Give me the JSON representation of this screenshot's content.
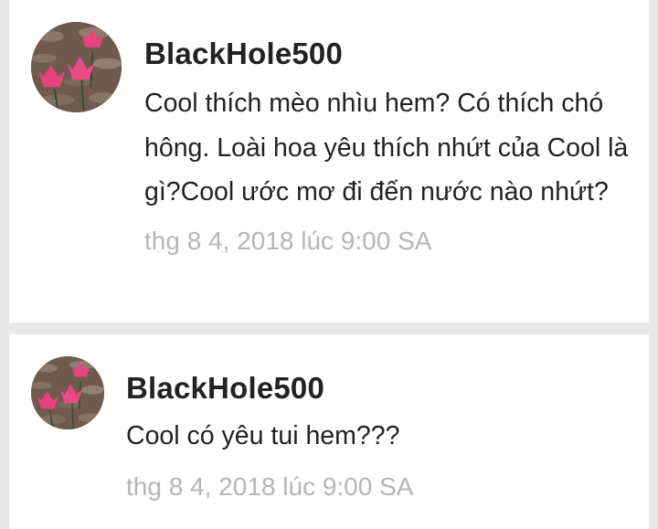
{
  "comments": [
    {
      "author": "BlackHole500",
      "text": "Cool thích mèo nhìu hem? Có thích chó hông. Loài hoa yêu thích nhứt của Cool là gì?Cool ước mơ đi đến nước nào nhứt?",
      "timestamp": "thg 8 4, 2018 lúc 9:00 SA",
      "avatar_icon": "lotus-flowers-avatar"
    },
    {
      "author": "BlackHole500",
      "text": "Cool có yêu tui hem???",
      "timestamp": "thg 8 4, 2018 lúc 9:00 SA",
      "avatar_icon": "lotus-flowers-avatar"
    }
  ],
  "colors": {
    "background": "#e8e8e8",
    "card": "#ffffff",
    "text": "#222222",
    "timestamp": "#b6b6b6",
    "flower": "#e8457f"
  }
}
